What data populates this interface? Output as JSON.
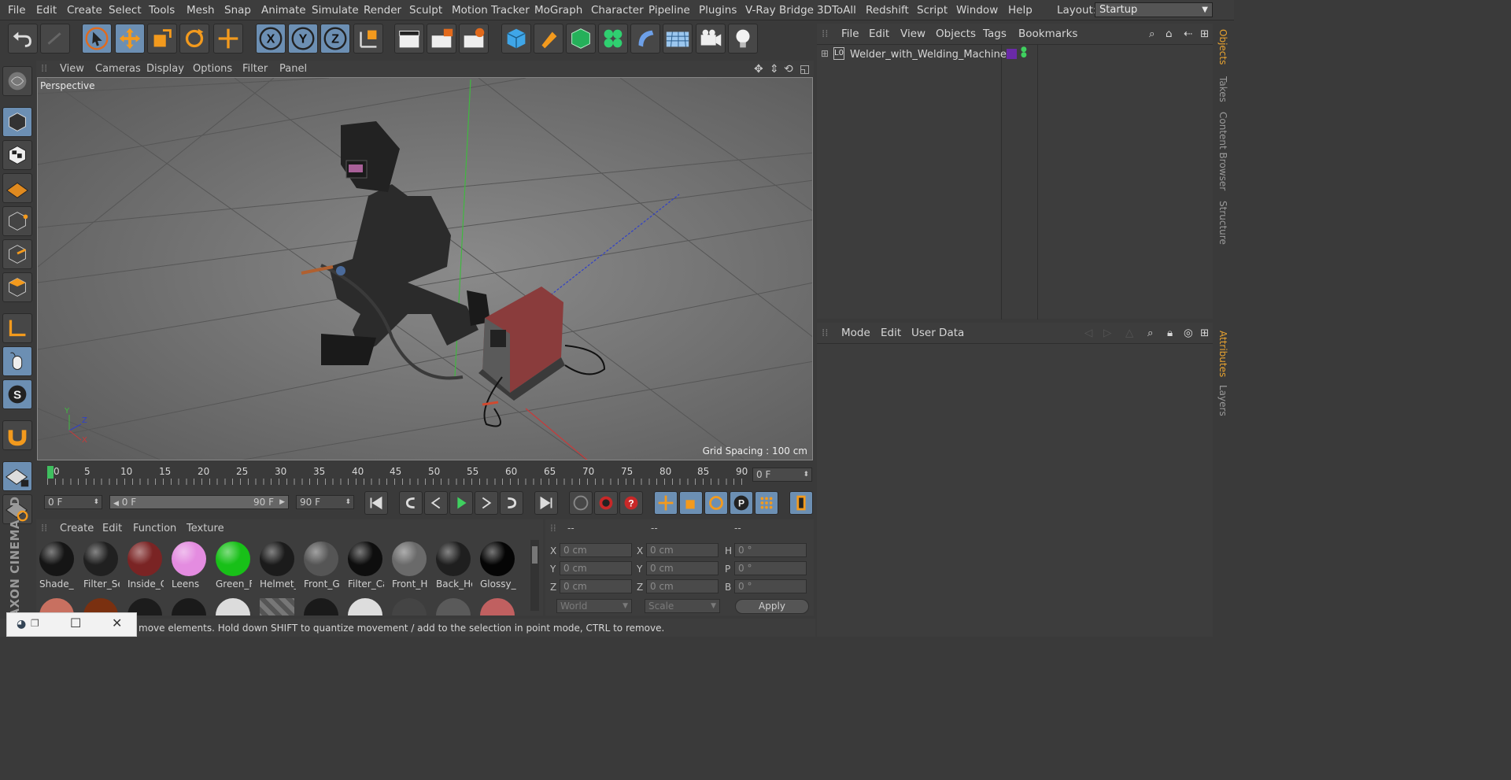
{
  "menu": [
    "File",
    "Edit",
    "Create",
    "Select",
    "Tools",
    "Mesh",
    "Snap",
    "Animate",
    "Simulate",
    "Render",
    "Sculpt",
    "Motion Tracker",
    "MoGraph",
    "Character",
    "Pipeline",
    "Plugins",
    "V-Ray Bridge",
    "3DToAll",
    "Redshift",
    "Script",
    "Window",
    "Help"
  ],
  "layout": {
    "label": "Layout:",
    "value": "Startup"
  },
  "viewport": {
    "menu": [
      "View",
      "Cameras",
      "Display",
      "Options",
      "Filter",
      "Panel"
    ],
    "camera": "Perspective",
    "grid_spacing": "Grid Spacing : 100 cm",
    "axis": {
      "y": "Y",
      "z": "Z",
      "x": "X"
    }
  },
  "timeline": {
    "ticks": [
      "0",
      "5",
      "10",
      "15",
      "20",
      "25",
      "30",
      "35",
      "40",
      "45",
      "50",
      "55",
      "60",
      "65",
      "70",
      "75",
      "80",
      "85",
      "90"
    ],
    "current": "0 F"
  },
  "transport": {
    "start": "0 F",
    "range_start": "0 F",
    "range_end": "90 F",
    "end": "90 F"
  },
  "materials": {
    "menu": [
      "Create",
      "Edit",
      "Function",
      "Texture"
    ],
    "items": [
      {
        "name": "Shade_",
        "color": "#151515"
      },
      {
        "name": "Filter_Se",
        "color": "#202020"
      },
      {
        "name": "Inside_C",
        "color": "#7a2424"
      },
      {
        "name": "Leens",
        "color": "#e48ce0"
      },
      {
        "name": "Green_F",
        "color": "#18c018"
      },
      {
        "name": "Helmet_",
        "color": "#1b1b1b"
      },
      {
        "name": "Front_G",
        "color": "#555"
      },
      {
        "name": "Filter_Ca",
        "color": "#0e0e0e"
      },
      {
        "name": "Front_H",
        "color": "#6a6a6a"
      },
      {
        "name": "Back_He",
        "color": "#1f1f1f"
      },
      {
        "name": "Glossy_",
        "color": "#050505"
      }
    ]
  },
  "coords": {
    "headers": [
      "--",
      "--",
      "--"
    ],
    "rows": [
      {
        "a": "X",
        "av": "0 cm",
        "b": "X",
        "bv": "0 cm",
        "c": "H",
        "cv": "0 °"
      },
      {
        "a": "Y",
        "av": "0 cm",
        "b": "Y",
        "bv": "0 cm",
        "c": "P",
        "cv": "0 °"
      },
      {
        "a": "Z",
        "av": "0 cm",
        "b": "Z",
        "bv": "0 cm",
        "c": "B",
        "cv": "0 °"
      }
    ],
    "world": "World",
    "scale": "Scale",
    "apply": "Apply"
  },
  "status": "move elements. Hold down SHIFT to quantize movement / add to the selection in point mode, CTRL to remove.",
  "objects": {
    "menu": [
      "File",
      "Edit",
      "View",
      "Objects",
      "Tags",
      "Bookmarks"
    ],
    "items": [
      {
        "name": "Welder_with_Welding_Machine"
      }
    ]
  },
  "attributes": {
    "menu": [
      "Mode",
      "Edit",
      "User Data"
    ]
  },
  "right_tabs": [
    "Objects",
    "Takes",
    "Content Browser",
    "Structure",
    "Attributes",
    "Layers"
  ],
  "brand": "MAXON CINEMA 4D"
}
